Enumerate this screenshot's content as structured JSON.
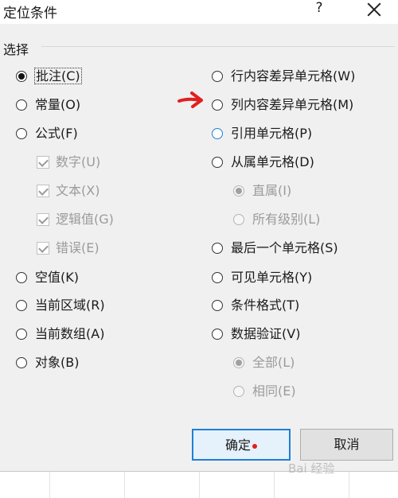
{
  "window": {
    "title": "定位条件",
    "help_label": "?"
  },
  "group": {
    "label": "选择"
  },
  "left_options": [
    {
      "label": "批注(C)",
      "type": "radio",
      "selected": true,
      "disabled": false,
      "focused_label": true
    },
    {
      "label": "常量(O)",
      "type": "radio",
      "selected": false,
      "disabled": false
    },
    {
      "label": "公式(F)",
      "type": "radio",
      "selected": false,
      "disabled": false
    },
    {
      "label": "数字(U)",
      "type": "checkbox",
      "checked": true,
      "disabled": true
    },
    {
      "label": "文本(X)",
      "type": "checkbox",
      "checked": true,
      "disabled": true
    },
    {
      "label": "逻辑值(G)",
      "type": "checkbox",
      "checked": true,
      "disabled": true
    },
    {
      "label": "错误(E)",
      "type": "checkbox",
      "checked": true,
      "disabled": true
    },
    {
      "label": "空值(K)",
      "type": "radio",
      "selected": false,
      "disabled": false
    },
    {
      "label": "当前区域(R)",
      "type": "radio",
      "selected": false,
      "disabled": false
    },
    {
      "label": "当前数组(A)",
      "type": "radio",
      "selected": false,
      "disabled": false
    },
    {
      "label": "对象(B)",
      "type": "radio",
      "selected": false,
      "disabled": false
    }
  ],
  "right_options": [
    {
      "label": "行内容差异单元格(W)",
      "type": "radio",
      "selected": false,
      "disabled": false
    },
    {
      "label": "列内容差异单元格(M)",
      "type": "radio",
      "selected": false,
      "disabled": false
    },
    {
      "label": "引用单元格(P)",
      "type": "radio",
      "selected": false,
      "disabled": false,
      "hover": true
    },
    {
      "label": "从属单元格(D)",
      "type": "radio",
      "selected": false,
      "disabled": false
    },
    {
      "label": "直属(I)",
      "type": "radio",
      "selected": true,
      "disabled": true
    },
    {
      "label": "所有级别(L)",
      "type": "radio",
      "selected": false,
      "disabled": true
    },
    {
      "label": "最后一个单元格(S)",
      "type": "radio",
      "selected": false,
      "disabled": false
    },
    {
      "label": "可见单元格(Y)",
      "type": "radio",
      "selected": false,
      "disabled": false
    },
    {
      "label": "条件格式(T)",
      "type": "radio",
      "selected": false,
      "disabled": false
    },
    {
      "label": "数据验证(V)",
      "type": "radio",
      "selected": false,
      "disabled": false
    },
    {
      "label": "全部(L)",
      "type": "radio",
      "selected": true,
      "disabled": true
    },
    {
      "label": "相同(E)",
      "type": "radio",
      "selected": false,
      "disabled": true
    }
  ],
  "buttons": {
    "ok_label": "确定",
    "cancel_label": "取消"
  },
  "watermark": {
    "text": "Bai 经验"
  },
  "colors": {
    "accent": "#1e7fd8",
    "annotation_red": "#e02020",
    "dialog_bg": "#f0f0f0"
  }
}
